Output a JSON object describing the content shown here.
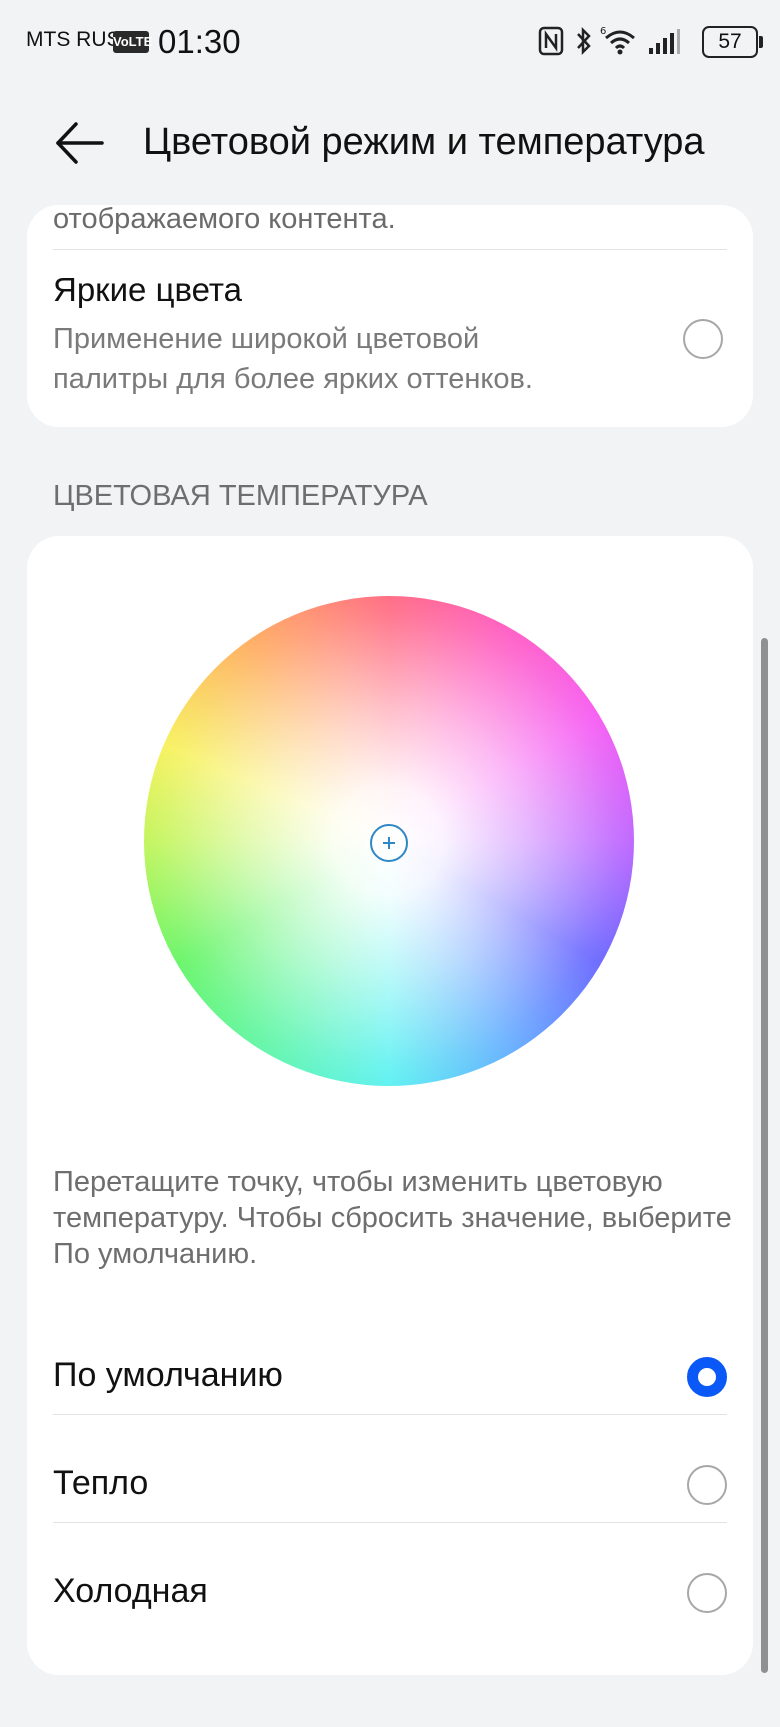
{
  "status_bar": {
    "carrier": "MTS RUS",
    "volte": "VoLTE",
    "time": "01:30",
    "battery": "57"
  },
  "header": {
    "title": "Цветовой режим и температура"
  },
  "color_mode": {
    "clipped_text": "отображаемого контента.",
    "vivid_title": "Яркие цвета",
    "vivid_description": "Применение широкой цветовой палитры для более ярких оттенков.",
    "vivid_selected": false
  },
  "color_temperature": {
    "section_label": "ЦВЕТОВАЯ ТЕМПЕРАТУРА",
    "hint": "Перетащите точку, чтобы изменить цветовую температуру. Чтобы сбросить значение, выберите По умолчанию.",
    "options": [
      {
        "label": "По умолчанию",
        "selected": true
      },
      {
        "label": "Тепло",
        "selected": false
      },
      {
        "label": "Холодная",
        "selected": false
      }
    ]
  },
  "colors": {
    "accent": "#0a59f7",
    "background": "#f1f3f5",
    "card": "#ffffff"
  }
}
